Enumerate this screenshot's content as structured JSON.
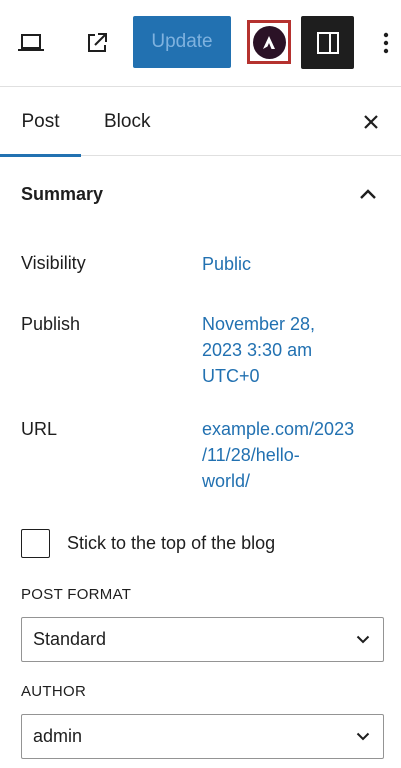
{
  "toolbar": {
    "preview_icon": "laptop-preview-icon",
    "external_icon": "external-link-icon",
    "update_label": "Update",
    "astra_icon": "astra-logo-icon",
    "settings_icon": "sidebar-settings-icon",
    "more_icon": "vertical-ellipsis-icon"
  },
  "tabs": {
    "post_label": "Post",
    "block_label": "Block",
    "close_icon": "close-icon"
  },
  "summary": {
    "title": "Summary",
    "toggle_icon": "chevron-up-icon",
    "visibility_label": "Visibility",
    "visibility_value": "Public",
    "publish_label": "Publish",
    "publish_value_line1": "November 28,",
    "publish_value_line2": "2023 3:30 am",
    "publish_value_line3": "UTC+0",
    "url_label": "URL",
    "url_value_line1": "example.com/2023",
    "url_value_line2": "/11/28/hello-",
    "url_value_line3": "world/",
    "stick_label": "Stick to the top of the blog",
    "stick_checked": false
  },
  "post_format": {
    "label": "POST FORMAT",
    "selected": "Standard"
  },
  "author": {
    "label": "AUTHOR",
    "selected": "admin"
  },
  "colors": {
    "accent": "#2271b1",
    "dark": "#1e1e1e",
    "astra_border": "#b5322f",
    "astra_bg": "#2b1226"
  }
}
